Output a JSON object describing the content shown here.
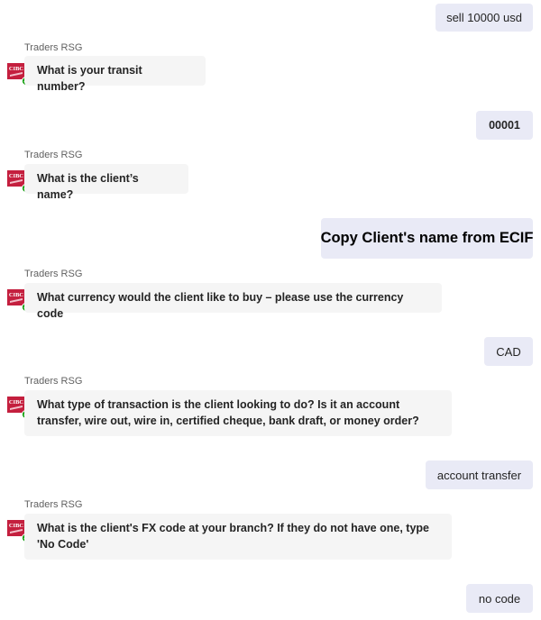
{
  "bot_name": "Traders RSG",
  "bot_logo_text": "CIBC",
  "colors": {
    "user_bubble": "#e9eaf6",
    "bot_bubble": "#f5f5f5",
    "logo_red": "#c41f3e",
    "status_green": "#13a10e"
  },
  "messages": [
    {
      "from": "user",
      "text": "sell 10000 usd"
    },
    {
      "from": "bot",
      "text": "What is your transit number?"
    },
    {
      "from": "user",
      "text": "00001"
    },
    {
      "from": "bot",
      "text": "What is the client’s name?"
    },
    {
      "from": "user",
      "text": "Copy Client's name from ECIF"
    },
    {
      "from": "bot",
      "text": "What currency would the client like to buy – please use the currency code"
    },
    {
      "from": "user",
      "text": "CAD"
    },
    {
      "from": "bot",
      "text": "What type of transaction is the client looking to do? Is it an account transfer, wire out, wire in, certified cheque, bank draft, or money order?"
    },
    {
      "from": "user",
      "text": "account transfer"
    },
    {
      "from": "bot",
      "text": "What is the client's FX code at your branch? If they do not have one, type 'No Code'"
    },
    {
      "from": "user",
      "text": "no code"
    }
  ]
}
